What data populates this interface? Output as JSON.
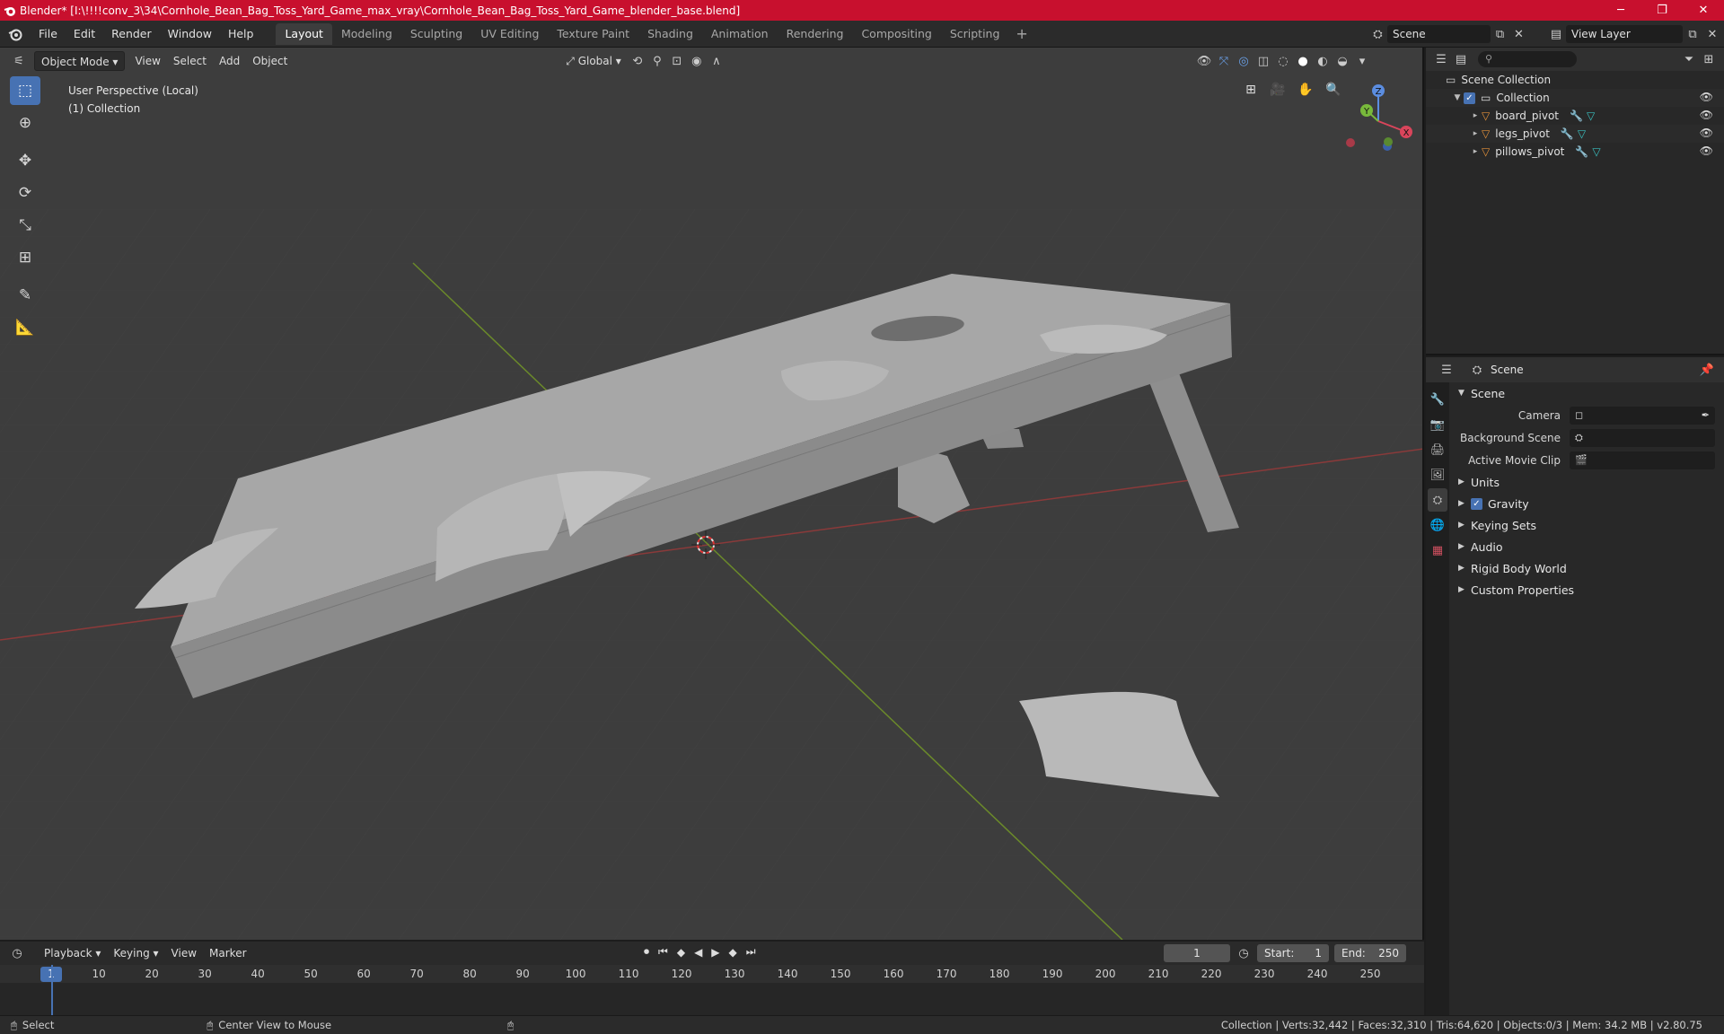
{
  "window": {
    "title": "Blender* [I:\\!!!!conv_3\\34\\Cornhole_Bean_Bag_Toss_Yard_Game_max_vray\\Cornhole_Bean_Bag_Toss_Yard_Game_blender_base.blend]",
    "minimize": "─",
    "maximize": "❐",
    "close": "✕"
  },
  "menu": {
    "file": "File",
    "edit": "Edit",
    "render": "Render",
    "window": "Window",
    "help": "Help"
  },
  "workspaces": [
    "Layout",
    "Modeling",
    "Sculpting",
    "UV Editing",
    "Texture Paint",
    "Shading",
    "Animation",
    "Rendering",
    "Compositing",
    "Scripting"
  ],
  "active_workspace": "Layout",
  "scene_selector": {
    "value": "Scene"
  },
  "view_layer_selector": {
    "value": "View Layer"
  },
  "viewport": {
    "mode": "Object Mode",
    "menus": {
      "view": "View",
      "select": "Select",
      "add": "Add",
      "object": "Object"
    },
    "transform_orientation": "Global",
    "info_line1": "User Perspective (Local)",
    "info_line2": "(1) Collection",
    "gizmo": {
      "x": "X",
      "y": "Y",
      "z": "Z"
    }
  },
  "outliner": {
    "scene_collection": "Scene Collection",
    "collection": "Collection",
    "objects": [
      "board_pivot",
      "legs_pivot",
      "pillows_pivot"
    ]
  },
  "properties": {
    "header": "Scene",
    "panel_title": "Scene",
    "camera_label": "Camera",
    "background_scene_label": "Background Scene",
    "active_movie_clip_label": "Active Movie Clip",
    "panels": [
      "Units",
      "Gravity",
      "Keying Sets",
      "Audio",
      "Rigid Body World",
      "Custom Properties"
    ]
  },
  "timeline": {
    "menus": {
      "playback": "Playback",
      "keying": "Keying",
      "view": "View",
      "marker": "Marker"
    },
    "current_frame": "1",
    "start_label": "Start:",
    "start": "1",
    "end_label": "End:",
    "end": "250",
    "ruler": [
      "1",
      "10",
      "20",
      "30",
      "40",
      "50",
      "60",
      "70",
      "80",
      "90",
      "100",
      "110",
      "120",
      "130",
      "140",
      "150",
      "160",
      "170",
      "180",
      "190",
      "200",
      "210",
      "220",
      "230",
      "240",
      "250"
    ]
  },
  "status": {
    "select": "Select",
    "center_view": "Center View to Mouse",
    "stats": "Collection | Verts:32,442 | Faces:32,310 | Tris:64,620 | Objects:0/3 | Mem: 34.2 MB | v2.80.75"
  }
}
